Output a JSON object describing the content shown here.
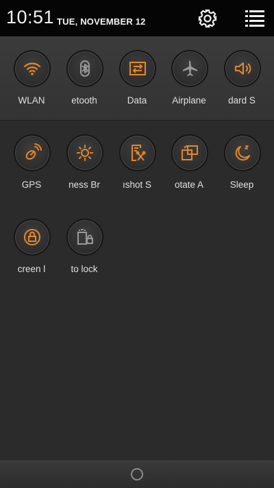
{
  "status": {
    "time": "10:51",
    "date": "TUE, NOVEMBER 12"
  },
  "colors": {
    "accent": "#e8872a",
    "inactive": "#9a9a9a",
    "background": "#2b2b2b"
  },
  "toggles_row1": [
    {
      "label": "WLAN",
      "icon": "wifi-icon",
      "active": true
    },
    {
      "label": "etooth",
      "icon": "bluetooth-icon",
      "active": false
    },
    {
      "label": "Data",
      "icon": "data-icon",
      "active": true
    },
    {
      "label": "Airplane",
      "icon": "airplane-icon",
      "active": false
    },
    {
      "label": "dard     S",
      "icon": "sound-icon",
      "active": true
    }
  ],
  "toggles_row2": [
    {
      "label": "GPS",
      "icon": "gps-icon",
      "active": true
    },
    {
      "label": "ness    Br",
      "icon": "brightness-icon",
      "active": true
    },
    {
      "label": "ıshot    S",
      "icon": "screenshot-icon",
      "active": true
    },
    {
      "label": "otate     A",
      "icon": "rotate-icon",
      "active": true
    },
    {
      "label": "Sleep",
      "icon": "sleep-icon",
      "active": true
    }
  ],
  "toggles_row3": [
    {
      "label": "creen     l",
      "icon": "screen-lock-icon",
      "active": true
    },
    {
      "label": "to lock",
      "icon": "auto-lock-icon",
      "active": false
    }
  ]
}
